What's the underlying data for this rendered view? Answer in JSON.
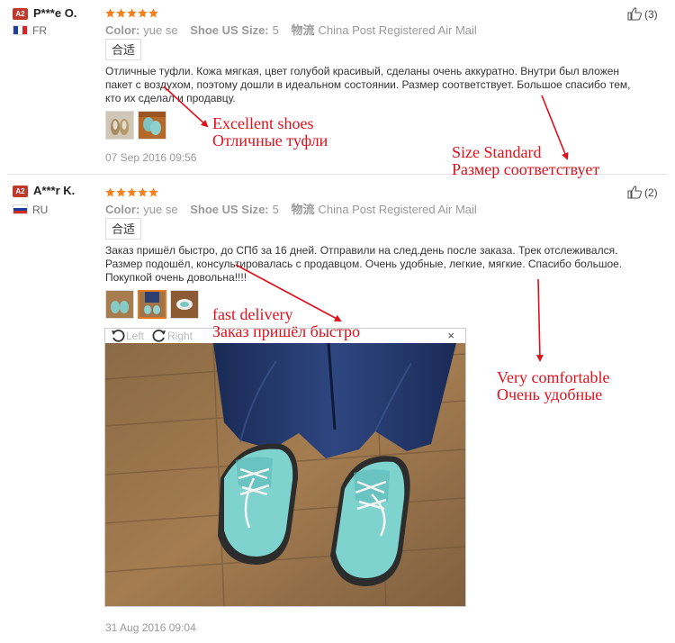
{
  "reviews": [
    {
      "badge": "A2",
      "user": "P***e O.",
      "country": "FR",
      "rating": 5,
      "color_label": "Color:",
      "color_value": "yue se",
      "size_label": "Shoe US Size:",
      "size_value": "5",
      "shipping_label": "物流",
      "shipping_value": "China Post Registered Air Mail",
      "tag": "合适",
      "text": "Отличные туфли. Кожа мягкая, цвет голубой красивый, сделаны очень аккуратно. Внутри был вложен пакет с воздухом, поэтому дошли в идеальном состоянии. Размер соответствует. Большое спасибо тем, кто их сделал и продавцу.",
      "date": "07 Sep 2016 09:56",
      "useful": "(3)"
    },
    {
      "badge": "A2",
      "user": "A***r K.",
      "country": "RU",
      "rating": 5,
      "color_label": "Color:",
      "color_value": "yue se",
      "size_label": "Shoe US Size:",
      "size_value": "5",
      "shipping_label": "物流",
      "shipping_value": "China Post Registered Air Mail",
      "tag": "合适",
      "text": "Заказ пришёл быстро, до СПб за 16 дней. Отправили на след.день после заказа. Трек отслеживался. Размер подошёл, консультировалась с продавцом. Очень удобные, легкие, мягкие. Спасибо большое. Покупкой очень довольна!!!!",
      "date": "31 Aug 2016 09:04",
      "useful": "(2)"
    }
  ],
  "viewer": {
    "left_label": "Left",
    "right_label": "Right",
    "close_label": "×"
  },
  "annotations": {
    "a1_en": "Excellent shoes",
    "a1_ru": "Отличные туфли",
    "a2_en": "Size Standard",
    "a2_ru": "Размер соответствует",
    "a3_en": "fast delivery",
    "a3_ru": "Заказ пришёл быстро",
    "a4_en": "Very comfortable",
    "a4_ru": "Очень удобные"
  },
  "colors": {
    "badge": "#c0392b",
    "star": "#f5821f",
    "annotation": "#e0101c",
    "accent": "#e87722"
  },
  "icons": [
    "thumbs-up-icon",
    "rotate-left-icon",
    "rotate-right-icon",
    "close-icon",
    "star-icon",
    "flag-fr-icon",
    "flag-ru-icon"
  ]
}
